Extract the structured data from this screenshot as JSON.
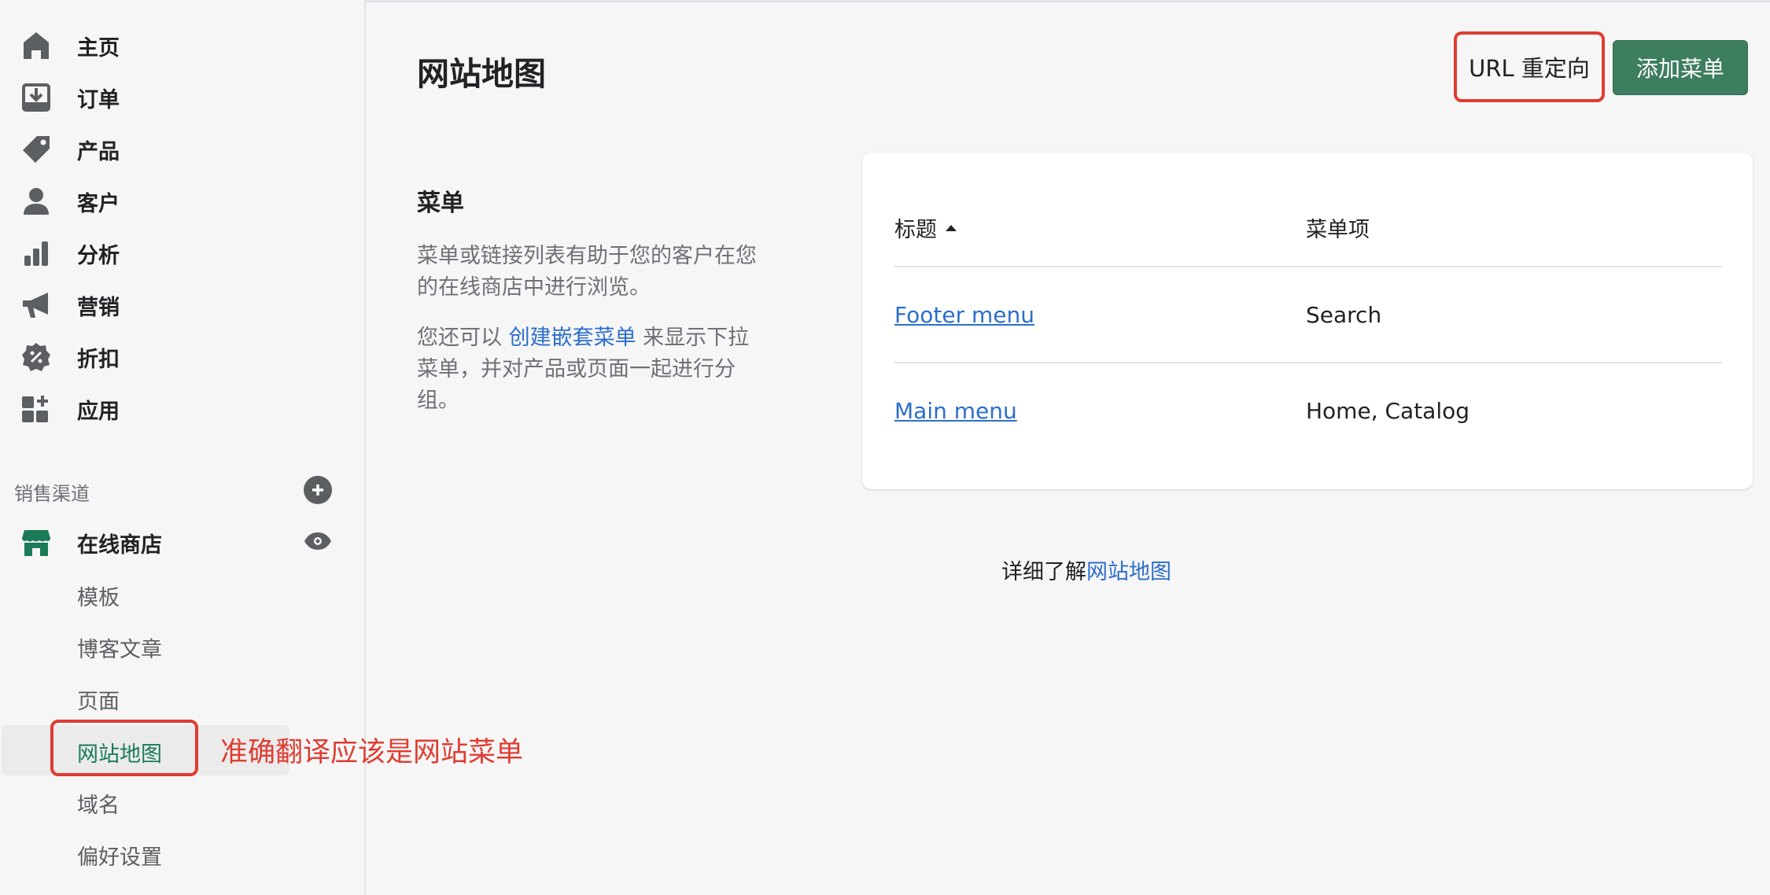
{
  "sidebar": {
    "items": [
      {
        "label": "主页",
        "icon": "home-icon"
      },
      {
        "label": "订单",
        "icon": "orders-icon"
      },
      {
        "label": "产品",
        "icon": "tag-icon"
      },
      {
        "label": "客户",
        "icon": "customer-icon"
      },
      {
        "label": "分析",
        "icon": "analytics-icon"
      },
      {
        "label": "营销",
        "icon": "megaphone-icon"
      },
      {
        "label": "折扣",
        "icon": "discount-icon"
      },
      {
        "label": "应用",
        "icon": "apps-icon"
      }
    ],
    "sales_channels_label": "销售渠道",
    "online_store_label": "在线商店",
    "sub_items": [
      "模板",
      "博客文章",
      "页面",
      "网站地图",
      "域名",
      "偏好设置"
    ],
    "active_sub_item": "网站地图"
  },
  "annotation": "准确翻译应该是网站菜单",
  "header": {
    "title": "网站地图",
    "url_redirect_label": "URL 重定向",
    "add_menu_label": "添加菜单"
  },
  "menus_section": {
    "title": "菜单",
    "desc1": "菜单或链接列表有助于您的客户在您的在线商店中进行浏览。",
    "desc2_prefix": "您还可以 ",
    "desc2_link": "创建嵌套菜单",
    "desc2_suffix": " 来显示下拉菜单，并对产品或页面一起进行分组。"
  },
  "table": {
    "col_title": "标题",
    "col_items": "菜单项",
    "rows": [
      {
        "title": "Footer menu",
        "items": "Search"
      },
      {
        "title": "Main menu",
        "items": "Home, Catalog"
      }
    ]
  },
  "footer": {
    "learn_prefix": "详细了解",
    "learn_link": "网站地图"
  },
  "colors": {
    "accent_green": "#3d7e5f",
    "link_blue": "#2c6ecb",
    "annotation_red": "#e03c31"
  }
}
